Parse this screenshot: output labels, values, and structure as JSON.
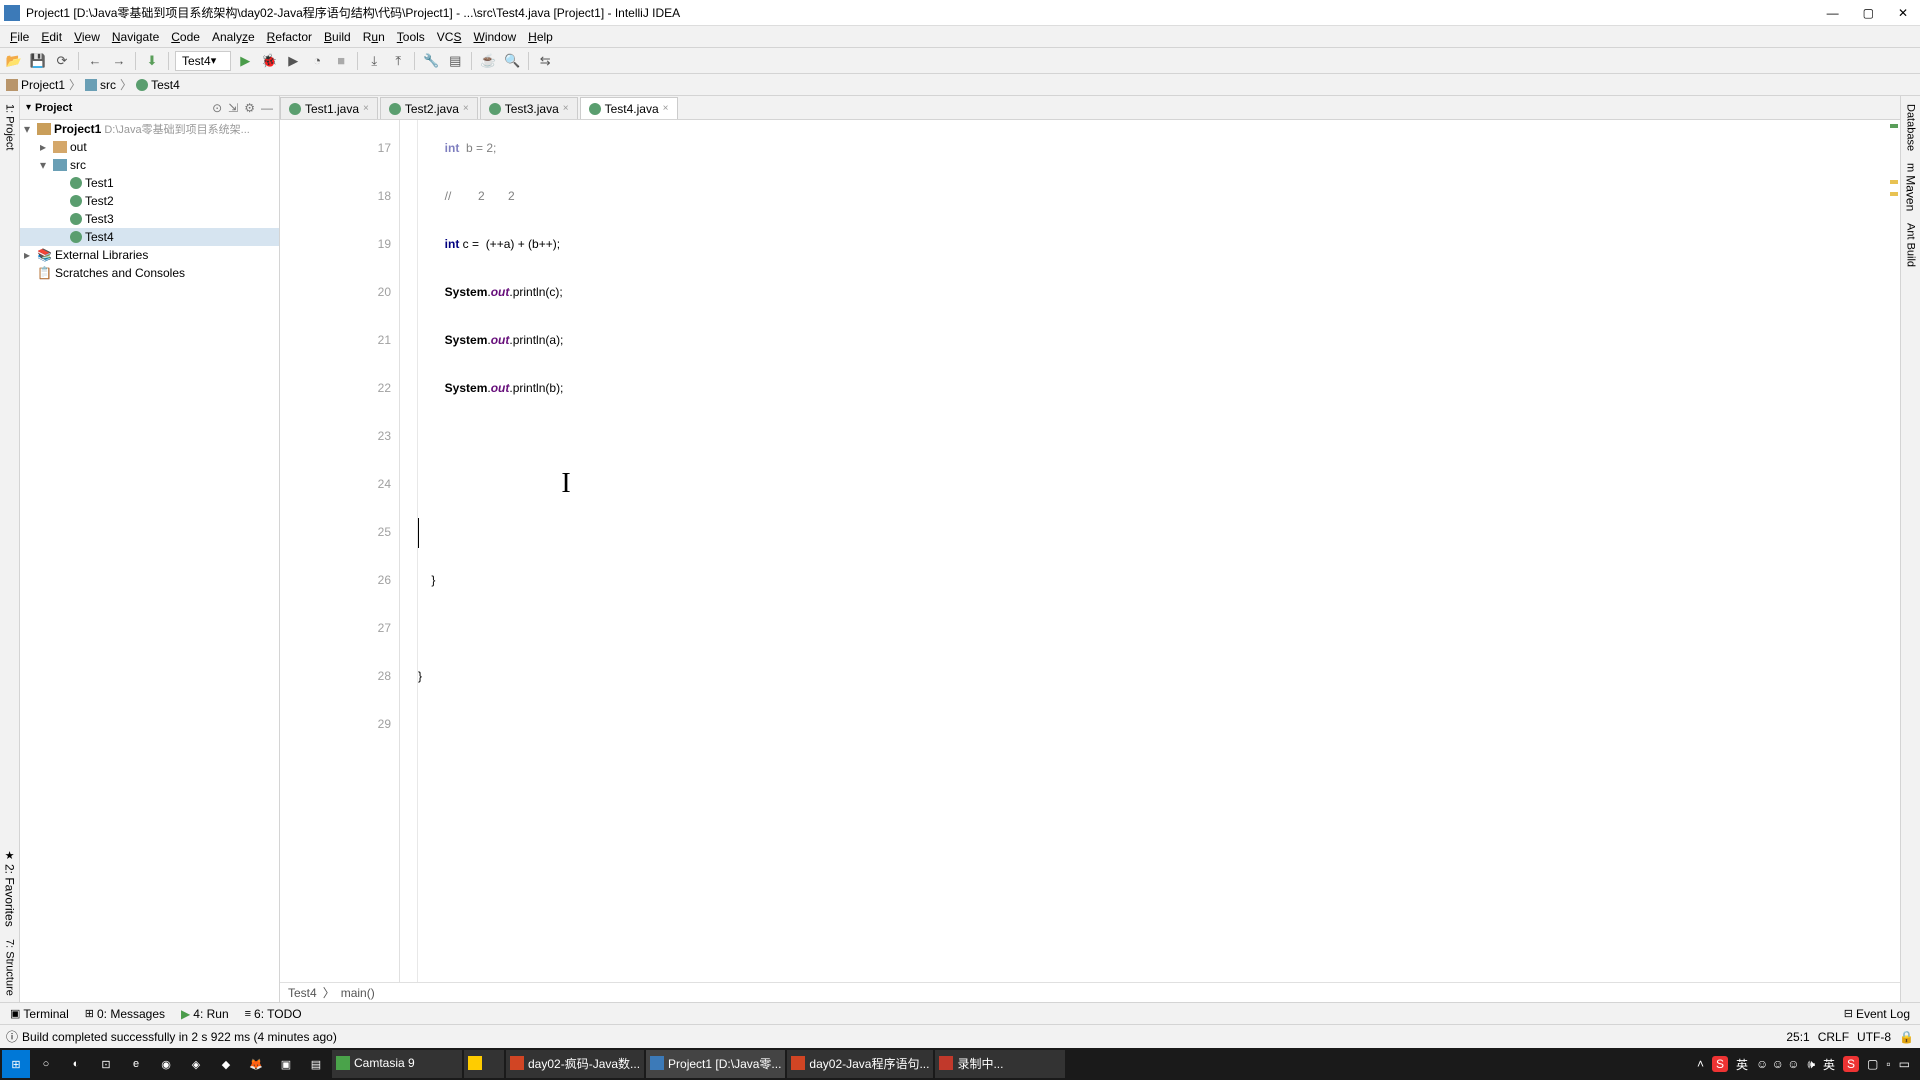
{
  "window": {
    "title": "Project1 [D:\\Java零基础到项目系统架构\\day02-Java程序语句结构\\代码\\Project1] - ...\\src\\Test4.java [Project1] - IntelliJ IDEA"
  },
  "menu": {
    "file": "File",
    "edit": "Edit",
    "view": "View",
    "navigate": "Navigate",
    "code": "Code",
    "analyze": "Analyze",
    "refactor": "Refactor",
    "build": "Build",
    "run": "Run",
    "tools": "Tools",
    "vcs": "VCS",
    "window": "Window",
    "help": "Help"
  },
  "toolbar": {
    "run_config": "Test4"
  },
  "nav": {
    "project": "Project1",
    "src": "src",
    "file": "Test4"
  },
  "project_panel": {
    "title": "Project",
    "root": "Project1",
    "root_path": "D:\\Java零基础到项目系统架...",
    "out": "out",
    "src": "src",
    "classes": [
      "Test1",
      "Test2",
      "Test3",
      "Test4"
    ],
    "ext": "External Libraries",
    "scratch": "Scratches and Consoles"
  },
  "tabs": [
    {
      "label": "Test1.java"
    },
    {
      "label": "Test2.java"
    },
    {
      "label": "Test3.java"
    },
    {
      "label": "Test4.java"
    }
  ],
  "gutter": [
    "17",
    "18",
    "19",
    "20",
    "21",
    "22",
    "23",
    "24",
    "25",
    "26",
    "27",
    "28",
    "29"
  ],
  "code": {
    "l17_pre": "        ",
    "l17_kw": "int",
    "l17_rest": "  b = 2;",
    "l18": "        //        2       2",
    "l19_pre": "        ",
    "l19_kw": "int",
    "l19_rest": " c =  (++a) + (b++);",
    "l20_pre": "        ",
    "l20_cls": "System",
    "l20_d": ".",
    "l20_fld": "out",
    "l20_rest": ".println(c);",
    "l21_pre": "        ",
    "l21_cls": "System",
    "l21_d": ".",
    "l21_fld": "out",
    "l21_rest": ".println(a);",
    "l22_pre": "        ",
    "l22_cls": "System",
    "l22_d": ".",
    "l22_fld": "out",
    "l22_rest": ".println(b);",
    "l26": "    }",
    "l28": "}"
  },
  "breadcrumb2": {
    "cls": "Test4",
    "method": "main()"
  },
  "bottom": {
    "terminal": "Terminal",
    "messages": "0: Messages",
    "run": "4: Run",
    "todo": "6: TODO",
    "eventlog": "Event Log"
  },
  "status": {
    "msg": "Build completed successfully in 2 s 922 ms (4 minutes ago)",
    "pos": "25:1",
    "eol": "CRLF",
    "enc": "UTF-8",
    "lock": "🔒"
  },
  "right_tabs": {
    "db": "Database",
    "maven": "Maven",
    "ant": "Ant Build"
  },
  "left_tabs": {
    "project": "1: Project",
    "fav": "2: Favorites",
    "struct": "7: Structure"
  },
  "taskbar": {
    "apps": [
      {
        "label": "Camtasia 9",
        "color": "#4aa34a"
      },
      {
        "label": "",
        "color": "#ffcc00"
      },
      {
        "label": "day02-疯码-Java数...",
        "color": "#d14524"
      },
      {
        "label": "Project1 [D:\\Java零...",
        "color": "#3c7ab8"
      },
      {
        "label": "day02-Java程序语句...",
        "color": "#d14524"
      },
      {
        "label": "录制中...",
        "color": "#c1392b"
      }
    ],
    "tray_time": "",
    "tray_lang": "英"
  }
}
